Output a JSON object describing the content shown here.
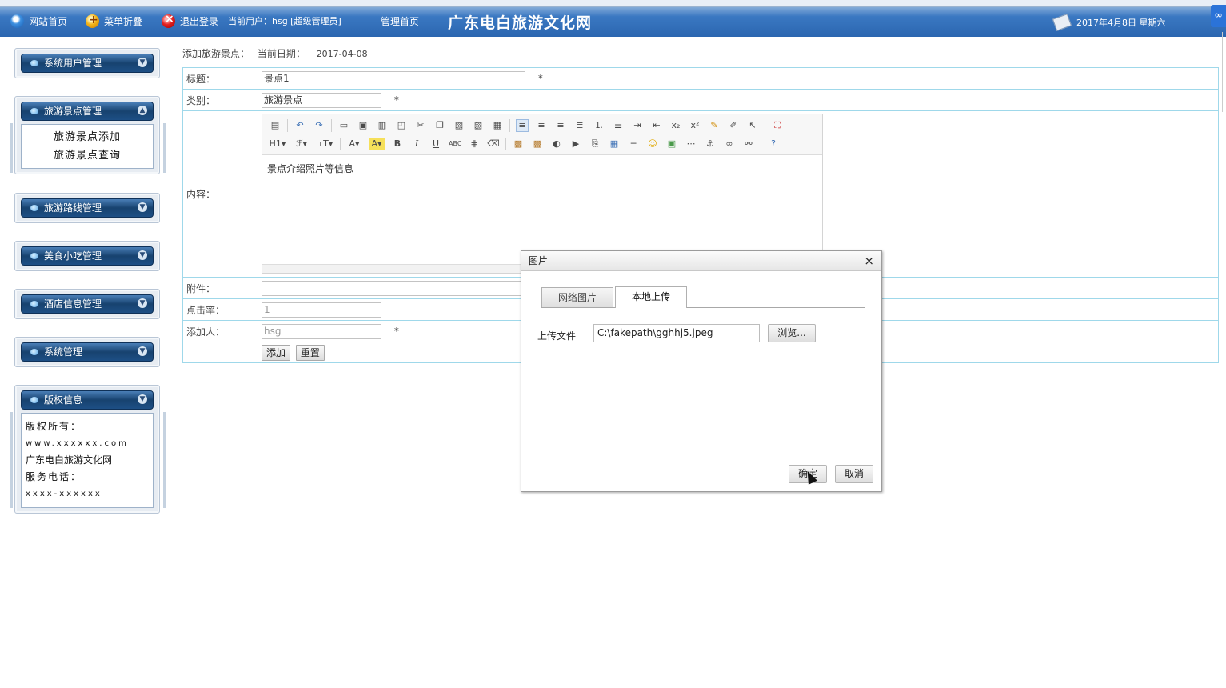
{
  "header": {
    "nav": [
      {
        "label": "网站首页",
        "icon": "home-icon"
      },
      {
        "label": "菜单折叠",
        "icon": "fold-icon"
      },
      {
        "label": "退出登录",
        "icon": "logout-icon"
      }
    ],
    "current_user": "当前用户：hsg [超级管理员]",
    "admin_home": "管理首页",
    "site_title": "广东电白旅游文化网",
    "date": "2017年4月8日 星期六"
  },
  "sidebar": {
    "menus": [
      {
        "title": "系统用户管理",
        "items": []
      },
      {
        "title": "旅游景点管理",
        "items": [
          "旅游景点添加",
          "旅游景点查询"
        ]
      },
      {
        "title": "旅游路线管理",
        "items": []
      },
      {
        "title": "美食小吃管理",
        "items": []
      },
      {
        "title": "酒店信息管理",
        "items": []
      },
      {
        "title": "系统管理",
        "items": []
      },
      {
        "title": "版权信息",
        "items": []
      }
    ],
    "copyright": {
      "owner_label": "版权所有：",
      "site": "www.xxxxxx.com",
      "name": "广东电白旅游文化网",
      "phone_label": "服务电话：",
      "phone": "xxxx-xxxxxx"
    }
  },
  "main": {
    "breadcrumb": "添加旅游景点：",
    "date_label": "当前日期：",
    "date_value": "2017-04-08",
    "form": {
      "title_label": "标题：",
      "title_value": "景点1",
      "category_label": "类别：",
      "category_value": "旅游景点",
      "content_label": "内容：",
      "content_value": "景点介绍照片等信息",
      "attachment_label": "附件：",
      "clicks_label": "点击率：",
      "clicks_value": "1",
      "author_label": "添加人：",
      "author_value": "hsg",
      "required_mark": "*",
      "submit_label": "添加",
      "reset_label": "重置"
    }
  },
  "dialog": {
    "title": "图片",
    "close": "×",
    "tabs": [
      "网络图片",
      "本地上传"
    ],
    "active_tab": "本地上传",
    "file_label": "上传文件",
    "file_value": "C:\\fakepath\\gghhj5.jpeg",
    "browse_label": "浏览...",
    "ok_label": "确定",
    "cancel_label": "取消"
  }
}
